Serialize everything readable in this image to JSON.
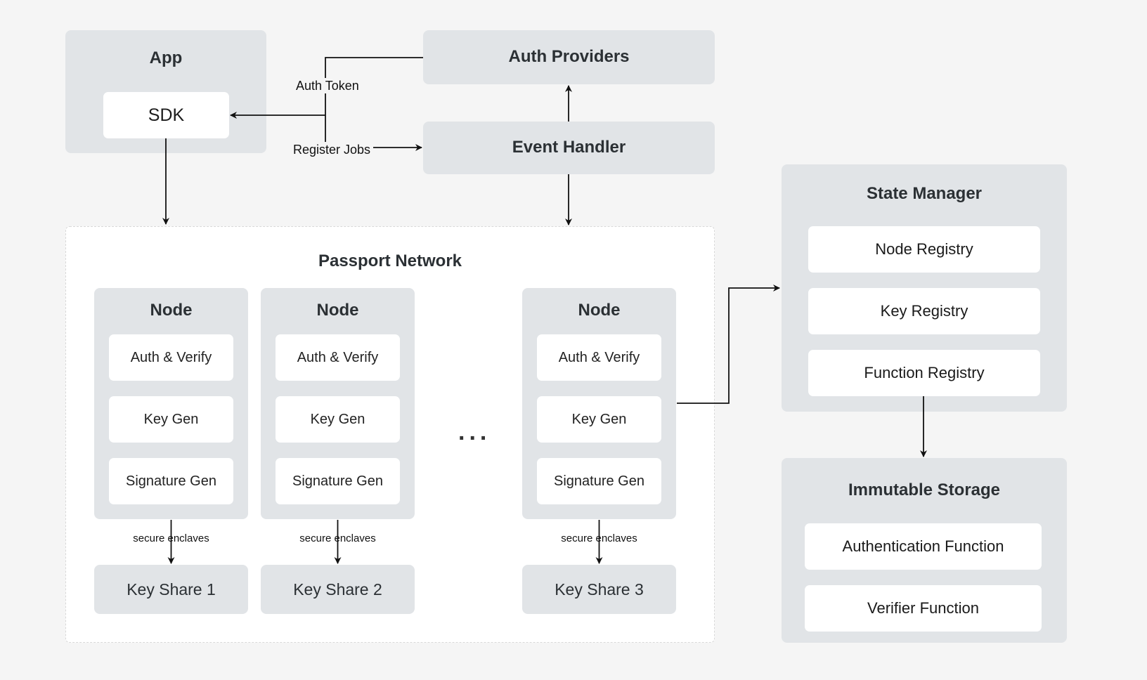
{
  "app": {
    "title": "App",
    "sdk": "SDK"
  },
  "auth_providers": {
    "title": "Auth Providers"
  },
  "event_handler": {
    "title": "Event Handler"
  },
  "edges": {
    "auth_token": "Auth Token",
    "register_jobs": "Register Jobs",
    "secure_enclaves": "secure enclaves"
  },
  "passport_network": {
    "title": "Passport Network",
    "ellipsis": "...",
    "nodes": [
      {
        "title": "Node",
        "items": [
          "Auth & Verify",
          "Key Gen",
          "Signature Gen"
        ],
        "key_share": "Key Share 1"
      },
      {
        "title": "Node",
        "items": [
          "Auth & Verify",
          "Key Gen",
          "Signature Gen"
        ],
        "key_share": "Key Share 2"
      },
      {
        "title": "Node",
        "items": [
          "Auth & Verify",
          "Key Gen",
          "Signature Gen"
        ],
        "key_share": "Key Share 3"
      }
    ]
  },
  "state_manager": {
    "title": "State Manager",
    "items": [
      "Node Registry",
      "Key Registry",
      "Function Registry"
    ]
  },
  "immutable_storage": {
    "title": "Immutable Storage",
    "items": [
      "Authentication Function",
      "Verifier Function"
    ]
  },
  "colors": {
    "background": "#f5f5f5",
    "container": "#e1e4e7",
    "inner_box": "#ffffff",
    "title_text": "#2b3034",
    "line": "#111111"
  }
}
